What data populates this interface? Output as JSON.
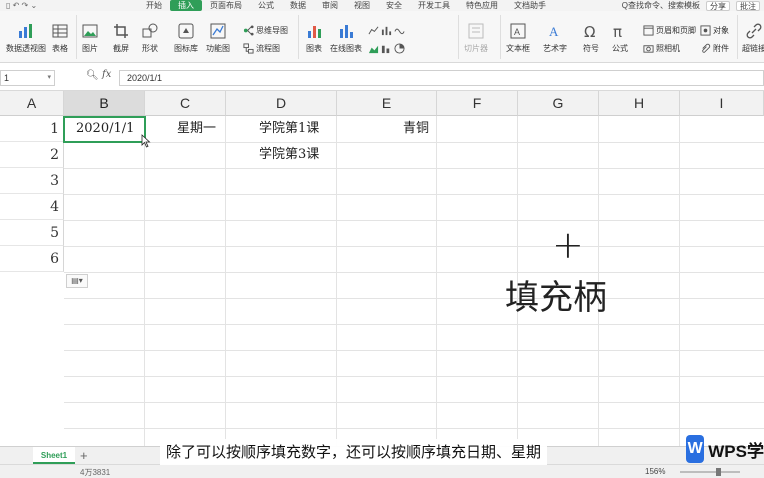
{
  "menu": {
    "quick_icons": "▯ ↶ ↷ ⌄",
    "tabs": [
      "开始",
      "插入",
      "页面布局",
      "公式",
      "数据",
      "审阅",
      "视图",
      "安全",
      "开发工具",
      "特色应用",
      "文档助手"
    ],
    "active_tab_index": 1,
    "search": "Q查找命令、搜索模板",
    "share": "分享",
    "comment": "批注"
  },
  "ribbon": {
    "pivot": "数据透视图",
    "table": "表格",
    "picture": "图片",
    "screenshot": "截屏",
    "shape": "形状",
    "icon_lib": "图标库",
    "func_lib": "功能图",
    "mindmap": "思维导图",
    "flowchart": "流程图",
    "chart": "图表",
    "online_chart": "在线图表",
    "slicer": "切片器",
    "textbox": "文本框",
    "wordart": "艺术字",
    "symbol": "符号",
    "formula": "公式",
    "header_footer": "页眉和页脚",
    "object": "对象",
    "camera": "照相机",
    "attachment": "附件",
    "hyperlink": "超链接"
  },
  "formula_bar": {
    "name_box": "1",
    "fx": "fx",
    "content": "2020/1/1"
  },
  "grid": {
    "columns": [
      "A",
      "B",
      "C",
      "D",
      "E",
      "F",
      "G",
      "H",
      "I"
    ],
    "rows": [
      "1",
      "2",
      "3",
      "4",
      "5",
      "6"
    ],
    "cells": {
      "B1": "2020/1/1",
      "C1": "星期一",
      "D1": "学院第1课",
      "E1": "青铜",
      "D2": "学院第3课"
    }
  },
  "annotation": {
    "plus": "+",
    "label": "填充柄"
  },
  "sheet": {
    "tab": "Sheet1",
    "add": "+",
    "status": "4万3831",
    "zoom": "156%"
  },
  "subtitle": "除了可以按顺序填充数字，还可以按顺序填充日期、星期",
  "brand": {
    "logo_letter": "W",
    "name": "WPS学"
  },
  "colors": {
    "accent_green": "#2f9e58",
    "wps_blue": "#2a6fe0"
  }
}
